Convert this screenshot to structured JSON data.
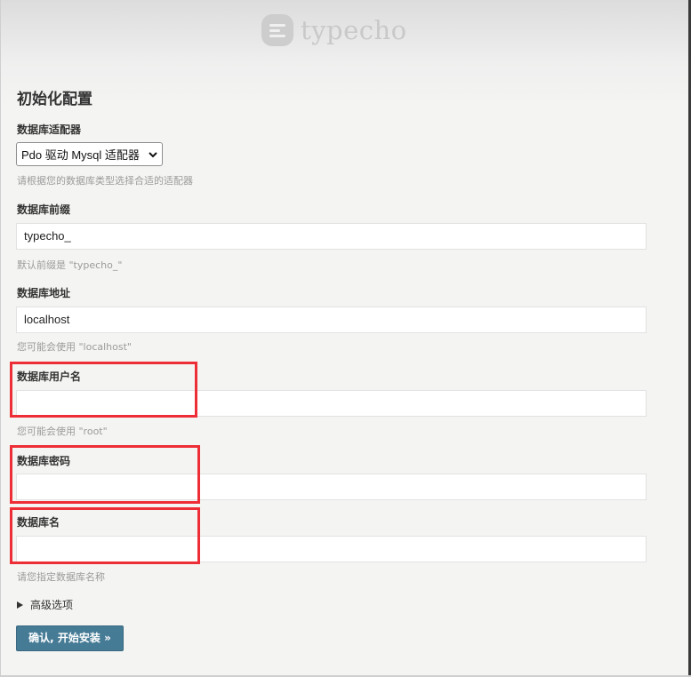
{
  "logo": {
    "text": "typecho"
  },
  "page_title": "初始化配置",
  "fields": {
    "adapter": {
      "label": "数据库适配器",
      "selected": "Pdo 驱动 Mysql 适配器",
      "hint": "请根据您的数据库类型选择合适的适配器"
    },
    "prefix": {
      "label": "数据库前缀",
      "value": "typecho_",
      "hint": "默认前缀是 \"typecho_\""
    },
    "host": {
      "label": "数据库地址",
      "value": "localhost",
      "hint": "您可能会使用 \"localhost\""
    },
    "user": {
      "label": "数据库用户名",
      "value": "",
      "hint": "您可能会使用 \"root\""
    },
    "password": {
      "label": "数据库密码",
      "value": ""
    },
    "dbname": {
      "label": "数据库名",
      "value": "",
      "hint": "请您指定数据库名称"
    }
  },
  "advanced_label": "高级选项",
  "submit_label": "确认, 开始安装 »",
  "colors": {
    "button": "#467b96",
    "highlight": "#ee2e36"
  }
}
